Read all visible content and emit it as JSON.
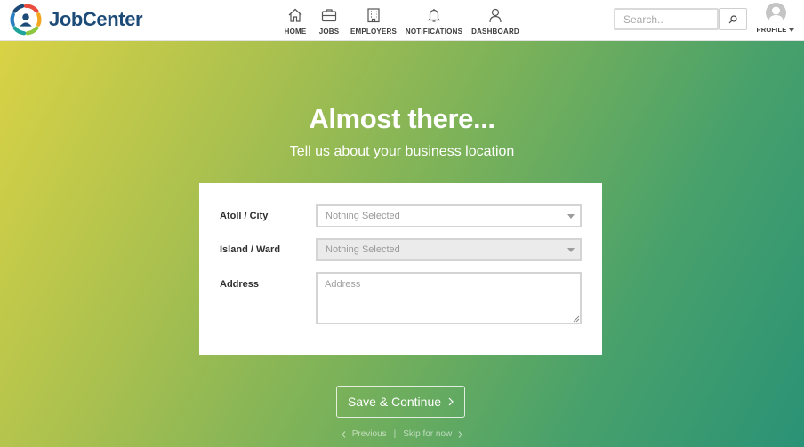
{
  "brand": {
    "name": "JobCenter"
  },
  "nav": {
    "items": [
      {
        "label": "HOME",
        "icon": "home-icon"
      },
      {
        "label": "JOBS",
        "icon": "briefcase-icon"
      },
      {
        "label": "EMPLOYERS",
        "icon": "building-icon"
      },
      {
        "label": "NOTIFICATIONS",
        "icon": "bell-icon"
      },
      {
        "label": "DASHBOARD",
        "icon": "user-icon"
      }
    ]
  },
  "search": {
    "placeholder": "Search..",
    "button_icon": "search-icon"
  },
  "profile": {
    "label": "PROFILE",
    "icon": "avatar-icon"
  },
  "hero": {
    "title": "Almost there...",
    "subtitle": "Tell us about your business location"
  },
  "form": {
    "atoll": {
      "label": "Atoll / City",
      "value": "Nothing Selected"
    },
    "island": {
      "label": "Island / Ward",
      "value": "Nothing Selected"
    },
    "address": {
      "label": "Address",
      "placeholder": "Address"
    }
  },
  "actions": {
    "save_label": "Save & Continue",
    "previous_label": "Previous",
    "separator": "|",
    "skip_label": "Skip for now"
  },
  "colors": {
    "brand_navy": "#1d4b78",
    "gradient": [
      "#d9d245",
      "#79b15a",
      "#2a9276"
    ]
  }
}
